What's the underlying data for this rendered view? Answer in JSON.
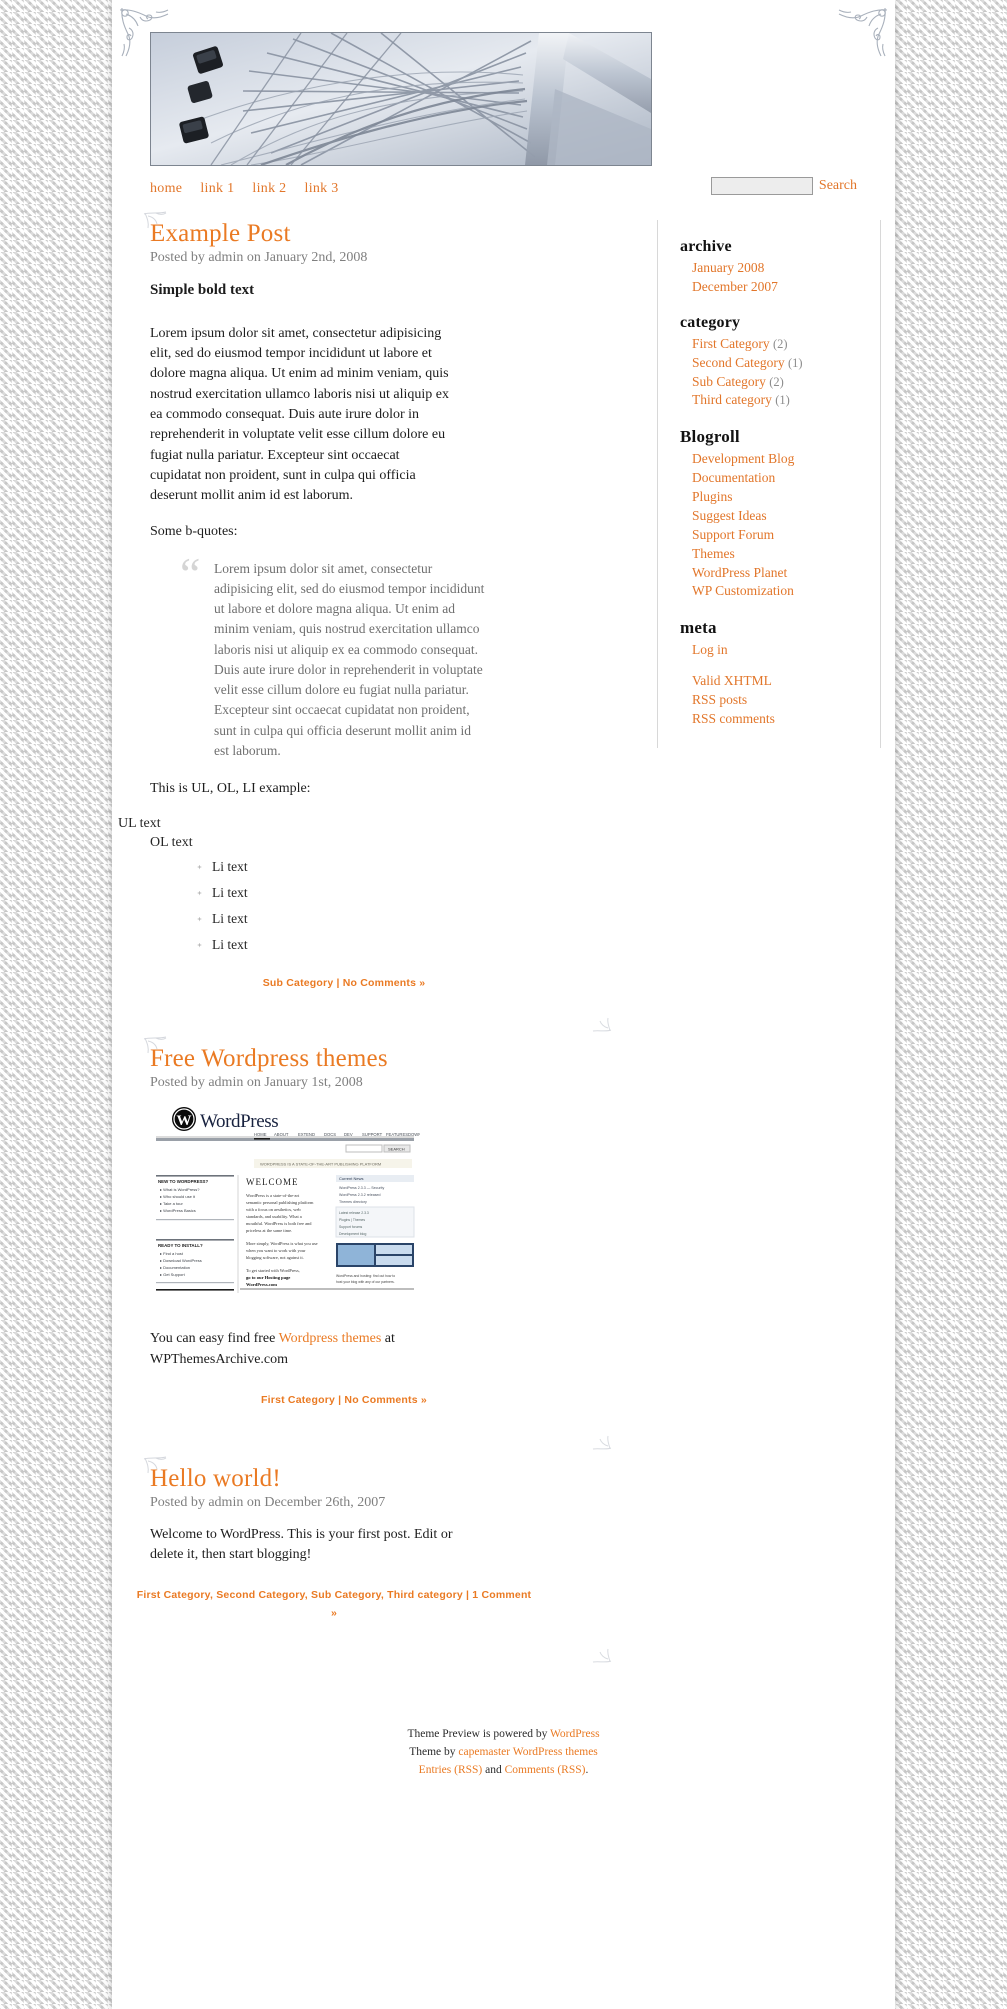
{
  "site": {
    "banner_alt": "ferris-wheel-photo"
  },
  "nav": {
    "items": [
      {
        "label": "home"
      },
      {
        "label": "link 1"
      },
      {
        "label": "link 2"
      },
      {
        "label": "link 3"
      }
    ]
  },
  "search": {
    "value": "",
    "placeholder": "",
    "label": "Search"
  },
  "posts": [
    {
      "title": "Example Post",
      "date": "Posted by admin on January 2nd, 2008",
      "bold_line": "Simple bold text",
      "para1": "Lorem ipsum dolor sit amet, consectetur adipisicing elit, sed do eiusmod tempor incididunt ut labore et dolore magna aliqua. Ut enim ad minim veniam, quis nostrud exercitation ullamco laboris nisi ut aliquip ex ea commodo consequat. Duis aute irure dolor in reprehenderit in voluptate velit esse cillum dolore eu fugiat nulla pariatur. Excepteur sint occaecat cupidatat non proident, sunt in culpa qui officia deserunt mollit anim id est laborum.",
      "para2": "Some b-quotes:",
      "blockquote": "Lorem ipsum dolor sit amet, consectetur adipisicing elit, sed do eiusmod tempor incididunt ut labore et dolore magna aliqua. Ut enim ad minim veniam, quis nostrud exercitation ullamco laboris nisi ut aliquip ex ea commodo consequat. Duis aute irure dolor in reprehenderit in voluptate velit esse cillum dolore eu fugiat nulla pariatur. Excepteur sint occaecat cupidatat non proident, sunt in culpa qui officia deserunt mollit anim id est laborum.",
      "para3": "This is UL, OL, LI example:",
      "ul_text": "UL text",
      "ol_text": "OL text",
      "li_items": [
        "Li text",
        "Li text",
        "Li text",
        "Li text"
      ],
      "meta_categories": [
        "Sub Category"
      ],
      "meta_comments": "No Comments »"
    },
    {
      "title": "Free Wordpress themes",
      "date": "Posted by admin on January 1st, 2008",
      "body_prefix": "You can easy find free ",
      "body_link": "Wordpress themes",
      "body_suffix": " at WPThemesArchive.com",
      "meta_categories": [
        "First Category"
      ],
      "meta_comments": "No Comments »"
    },
    {
      "title": "Hello world!",
      "date": "Posted by admin on December 26th, 2007",
      "body": "Welcome to WordPress. This is your first post. Edit or delete it, then start blogging!",
      "meta_categories": [
        "First Category",
        "Second Category",
        "Sub Category",
        "Third category"
      ],
      "meta_comments": "1 Comment »"
    }
  ],
  "sidebar": {
    "archive": {
      "heading": "archive",
      "items": [
        {
          "label": "January 2008"
        },
        {
          "label": "December 2007"
        }
      ]
    },
    "category": {
      "heading": "category",
      "items": [
        {
          "label": "First Category",
          "count": "(2)"
        },
        {
          "label": "Second Category",
          "count": "(1)"
        },
        {
          "label": "Sub Category",
          "count": "(2)"
        },
        {
          "label": "Third category",
          "count": "(1)"
        }
      ]
    },
    "blogroll": {
      "heading": "Blogroll",
      "items": [
        {
          "label": "Development Blog"
        },
        {
          "label": "Documentation"
        },
        {
          "label": "Plugins"
        },
        {
          "label": "Suggest Ideas"
        },
        {
          "label": "Support Forum"
        },
        {
          "label": "Themes"
        },
        {
          "label": "WordPress Planet"
        },
        {
          "label": "WP Customization"
        }
      ]
    },
    "meta": {
      "heading": "meta",
      "items": [
        {
          "label": "Log in"
        }
      ],
      "extra_items": [
        {
          "label": "Valid XHTML"
        },
        {
          "label": "RSS posts"
        },
        {
          "label": "RSS comments"
        }
      ]
    }
  },
  "footer": {
    "line1_prefix": "Theme Preview is powered by ",
    "line1_link": "WordPress",
    "line2_prefix": "Theme by ",
    "line2_link1": "capemaster",
    "line2_link2": "WordPress themes",
    "line3_link1": "Entries (RSS)",
    "line3_mid": " and ",
    "line3_link2": "Comments (RSS)",
    "line3_end": "."
  },
  "colors": {
    "accent": "#ea7a23",
    "link": "#e2762a",
    "text": "#1d1d1d",
    "muted": "#7f7f7f"
  }
}
